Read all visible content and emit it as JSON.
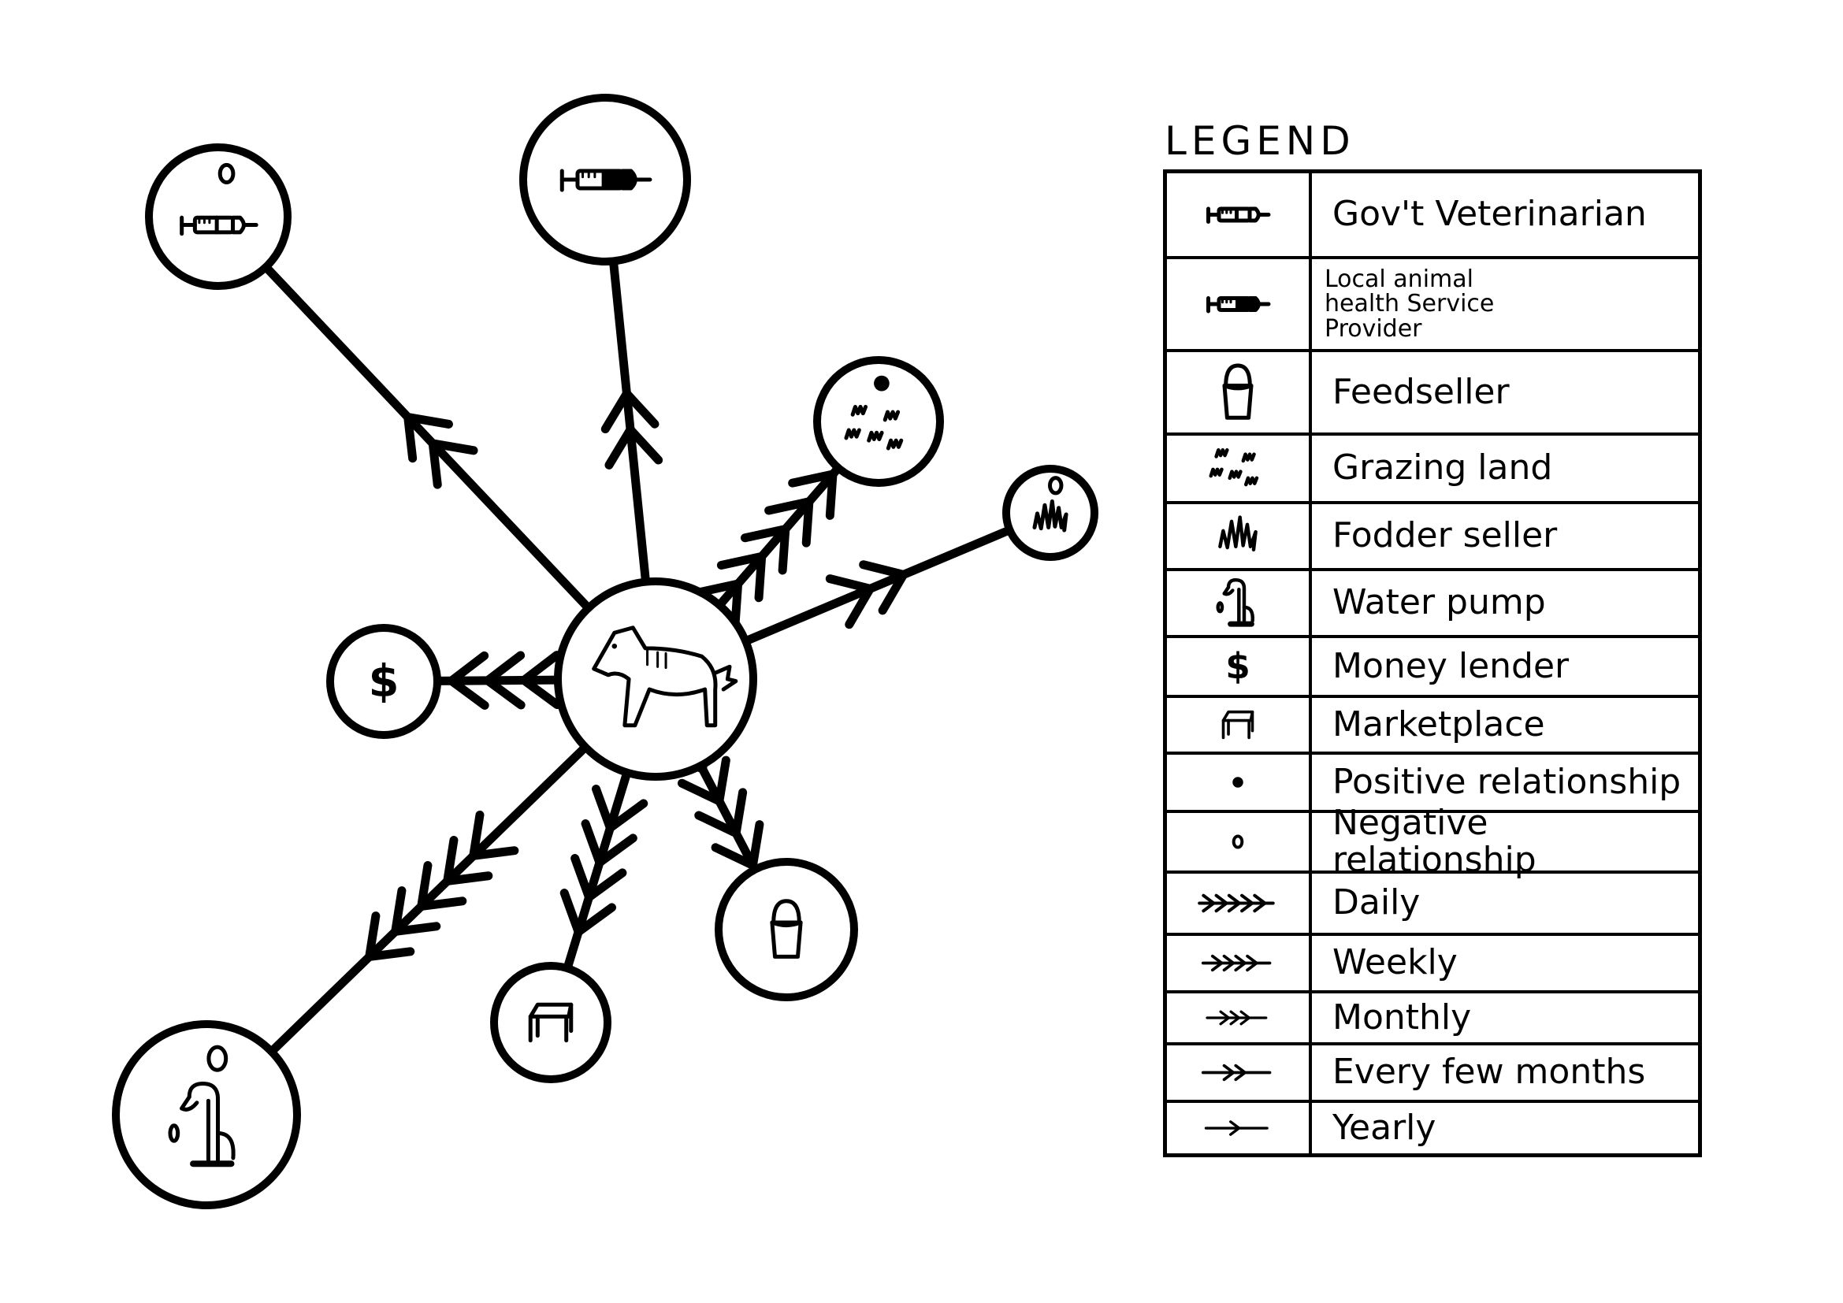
{
  "diagram": {
    "type": "venn-relationship-map",
    "center": {
      "id": "livestock",
      "label": "Livestock (cow)",
      "icon": "cow-icon"
    },
    "nodes": [
      {
        "id": "govt-vet",
        "label": "Gov't Veterinarian",
        "icon": "syringe-empty-icon",
        "frequency": "Every few months",
        "chevrons": 2,
        "relationship": "negative",
        "direction": "outward"
      },
      {
        "id": "local-ahsp",
        "label": "Local animal health Service Provider",
        "icon": "syringe-filled-icon",
        "frequency": "Every few months",
        "chevrons": 2,
        "relationship": "none",
        "direction": "outward"
      },
      {
        "id": "grazing-land",
        "label": "Grazing land",
        "icon": "grass-tufts-icon",
        "frequency": "Daily",
        "chevrons": 5,
        "relationship": "positive",
        "direction": "outward"
      },
      {
        "id": "fodder-seller",
        "label": "Fodder seller",
        "icon": "fodder-grass-icon",
        "frequency": "Every few months",
        "chevrons": 2,
        "relationship": "negative",
        "direction": "outward"
      },
      {
        "id": "money-lender",
        "label": "Money lender",
        "icon": "dollar-icon",
        "frequency": "Monthly",
        "chevrons": 3,
        "relationship": "none",
        "direction": "outward"
      },
      {
        "id": "feed-seller",
        "label": "Feedseller",
        "icon": "bucket-icon",
        "frequency": "Weekly",
        "chevrons": 4,
        "relationship": "none",
        "direction": "outward"
      },
      {
        "id": "marketplace",
        "label": "Marketplace",
        "icon": "table-icon",
        "frequency": "Weekly",
        "chevrons": 4,
        "relationship": "none",
        "direction": "outward"
      },
      {
        "id": "water-pump",
        "label": "Water pump",
        "icon": "water-pump-icon",
        "frequency": "Daily",
        "chevrons": 5,
        "relationship": "negative",
        "direction": "outward"
      }
    ]
  },
  "legend": {
    "title": "LEGEND",
    "rows": [
      {
        "symbol": "syringe-empty-icon",
        "label": "Gov't Veterinarian"
      },
      {
        "symbol": "syringe-filled-icon",
        "label": "Local animal\nhealth Service\nProvider",
        "small": true
      },
      {
        "symbol": "bucket-icon",
        "label": "Feedseller"
      },
      {
        "symbol": "grass-tufts-icon",
        "label": "Grazing land"
      },
      {
        "symbol": "fodder-grass-icon",
        "label": "Fodder seller"
      },
      {
        "symbol": "water-pump-icon",
        "label": "Water pump"
      },
      {
        "symbol": "dollar-icon",
        "label": "Money lender"
      },
      {
        "symbol": "table-icon",
        "label": "Marketplace"
      },
      {
        "symbol": "filled-dot-icon",
        "label": "Positive relationship"
      },
      {
        "symbol": "hollow-dot-icon",
        "label": "Negative relationship"
      },
      {
        "symbol": "arrow-5-chevrons-icon",
        "label": "Daily",
        "chevrons": 5
      },
      {
        "symbol": "arrow-4-chevrons-icon",
        "label": "Weekly",
        "chevrons": 4
      },
      {
        "symbol": "arrow-3-chevrons-icon",
        "label": "Monthly",
        "chevrons": 3
      },
      {
        "symbol": "arrow-2-chevrons-icon",
        "label": "Every few months",
        "chevrons": 2
      },
      {
        "symbol": "arrow-1-chevron-icon",
        "label": "Yearly",
        "chevrons": 1
      }
    ]
  }
}
